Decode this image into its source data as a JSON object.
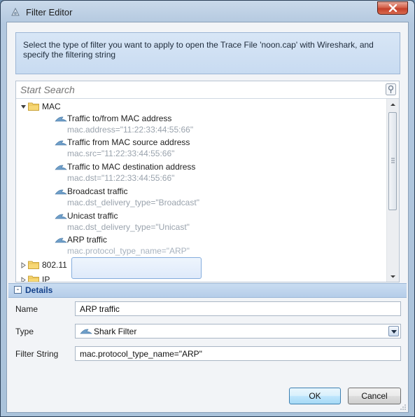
{
  "window": {
    "title": "Filter Editor"
  },
  "instructions": "Select the type of filter you want to apply to open the Trace File 'noon.cap' with Wireshark, and specify the filtering string",
  "search": {
    "placeholder": "Start Search"
  },
  "tree": {
    "groups": [
      {
        "label": "MAC",
        "expanded": true,
        "items": [
          {
            "label": "Traffic to/from MAC address",
            "filter": "mac.address=\"11:22:33:44:55:66\""
          },
          {
            "label": "Traffic from MAC source address",
            "filter": "mac.src=\"11:22:33:44:55:66\""
          },
          {
            "label": "Traffic to MAC destination address",
            "filter": "mac.dst=\"11:22:33:44:55:66\""
          },
          {
            "label": "Broadcast traffic",
            "filter": "mac.dst_delivery_type=\"Broadcast\""
          },
          {
            "label": "Unicast traffic",
            "filter": "mac.dst_delivery_type=\"Unicast\""
          },
          {
            "label": "ARP traffic",
            "filter": "mac.protocol_type_name=\"ARP\"",
            "selected": true
          }
        ]
      },
      {
        "label": "802.11",
        "expanded": false
      },
      {
        "label": "IP",
        "expanded": false
      }
    ]
  },
  "details": {
    "header": "Details",
    "collapse_symbol": "-",
    "name_label": "Name",
    "name_value": "ARP traffic",
    "type_label": "Type",
    "type_value": "Shark Filter",
    "filter_label": "Filter String",
    "filter_value": "mac.protocol_type_name=\"ARP\""
  },
  "buttons": {
    "ok": "OK",
    "cancel": "Cancel"
  },
  "colors": {
    "accent": "#15428b",
    "secondary_text": "#9aa3ad",
    "selection_border": "#84acdd"
  }
}
